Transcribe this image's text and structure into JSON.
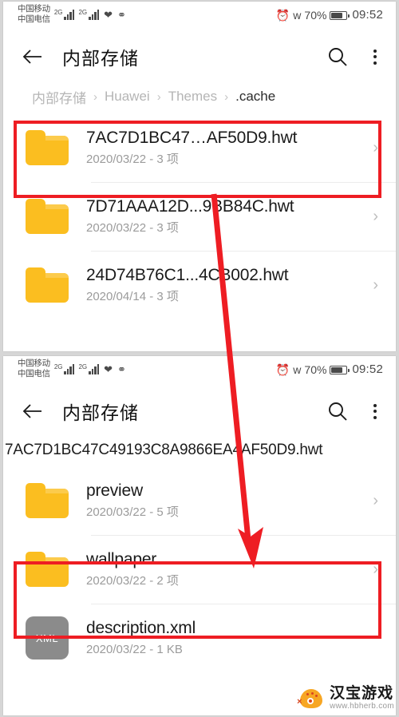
{
  "status_bar": {
    "carrier_primary": "中国移动",
    "carrier_secondary": "中国电信",
    "network_type_1": "2G",
    "network_type_2": "2G",
    "icons": [
      "health-icon",
      "wechat-icon",
      "alarm-icon",
      "bluetooth-icon"
    ],
    "battery_percent": "70%",
    "time": "09:52"
  },
  "screen_1": {
    "appbar": {
      "back": "back-arrow-icon",
      "title": "内部存储",
      "search": "search-icon",
      "overflow": "more-options-icon"
    },
    "breadcrumb": {
      "separator": "›",
      "crumbs": [
        {
          "label": "内部存储",
          "active": false
        },
        {
          "label": "Huawei",
          "active": false
        },
        {
          "label": "Themes",
          "active": false
        },
        {
          "label": ".cache",
          "active": true
        }
      ]
    },
    "rows": [
      {
        "icon": "folder-icon",
        "title": "7AC7D1BC47…AF50D9.hwt",
        "subtitle": "2020/03/22 - 3 项",
        "chevron": "›",
        "highlighted": true
      },
      {
        "icon": "folder-icon",
        "title": "7D71AAA12D...9BB84C.hwt",
        "subtitle": "2020/03/22 - 3 项",
        "chevron": "›",
        "highlighted": false
      },
      {
        "icon": "folder-icon",
        "title": "24D74B76C1...4CB002.hwt",
        "subtitle": "2020/04/14 - 3 项",
        "chevron": "›",
        "highlighted": false
      }
    ]
  },
  "screen_2": {
    "appbar": {
      "back": "back-arrow-icon",
      "title": "内部存储",
      "search": "search-icon",
      "overflow": "more-options-icon"
    },
    "path": "7AC7D1BC47C49193C8A9866EA4AF50D9.hwt",
    "rows": [
      {
        "icon": "folder-icon",
        "title": "preview",
        "subtitle": "2020/03/22 - 5 项",
        "chevron": "›",
        "highlighted": false
      },
      {
        "icon": "folder-icon",
        "title": "wallpaper",
        "subtitle": "2020/03/22 - 2 项",
        "chevron": "›",
        "highlighted": true
      },
      {
        "icon": "xml-file-icon",
        "icon_label": "XML",
        "title": "description.xml",
        "subtitle": "2020/03/22 - 1 KB",
        "chevron": "",
        "highlighted": false
      }
    ]
  },
  "annotations": {
    "highlight_color": "#ee1d23",
    "arrow_color": "#ee1d23",
    "boxes": 2,
    "arrow": "points from first highlighted folder down to wallpaper folder"
  },
  "watermark": {
    "title": "汉宝游戏",
    "url": "www.hbherb.com",
    "logo": "hbherb-logo-icon"
  },
  "colors": {
    "folder": "#FBBE20",
    "xml_icon": "#8b8b8b",
    "annotation_red": "#ee1d23",
    "title_text": "#1a1a1a",
    "sub_text": "#9b9b9b"
  }
}
